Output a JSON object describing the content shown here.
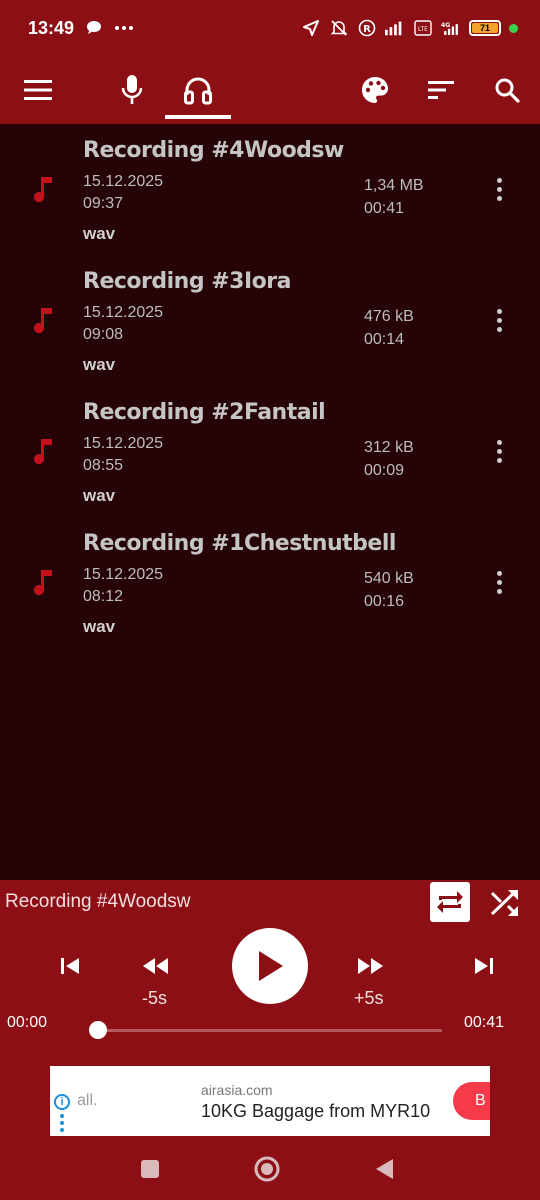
{
  "status_bar": {
    "time": "13:49",
    "battery_level": "71",
    "network": "4G"
  },
  "toolbar": {
    "menu_icon": "hamburger-icon",
    "record_icon": "microphone-icon",
    "player_icon": "headphones-icon",
    "theme_icon": "palette-icon",
    "sort_icon": "sort-icon",
    "search_icon": "search-icon",
    "active_tab": "player"
  },
  "recordings": [
    {
      "title": "Recording #4Woodsw",
      "date": "15.12.2025",
      "time": "09:37",
      "format": "wav",
      "size": "1,34 MB",
      "duration": "00:41"
    },
    {
      "title": "Recording #3Iora",
      "date": "15.12.2025",
      "time": "09:08",
      "format": "wav",
      "size": "476 kB",
      "duration": "00:14"
    },
    {
      "title": "Recording #2Fantail",
      "date": "15.12.2025",
      "time": "08:55",
      "format": "wav",
      "size": "312 kB",
      "duration": "00:09"
    },
    {
      "title": "Recording #1Chestnutbell",
      "date": "15.12.2025",
      "time": "08:12",
      "format": "wav",
      "size": "540 kB",
      "duration": "00:16"
    }
  ],
  "player": {
    "now_playing": "Recording #4Woodsw",
    "rewind_label": "-5s",
    "forward_label": "+5s",
    "current_time": "00:00",
    "total_time": "00:41",
    "progress": 0
  },
  "ad": {
    "brand_text": "all.",
    "domain": "airasia.com",
    "headline": "10KG Baggage from MYR10",
    "cta": "B"
  },
  "colors": {
    "primary": "#8c0f15",
    "list_bg": "#250307",
    "accent_icon": "#c3121c"
  }
}
